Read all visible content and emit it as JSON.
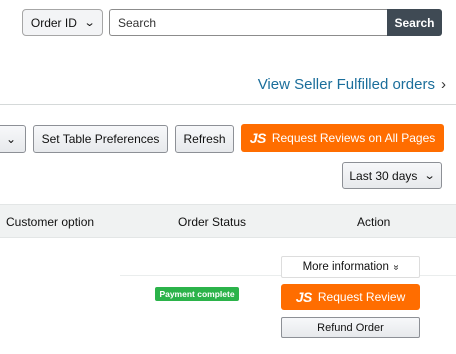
{
  "search": {
    "filter_label": "Order ID",
    "placeholder": "Search",
    "button_label": "Search"
  },
  "links": {
    "seller_fulfilled": "View Seller Fulfilled orders",
    "seller_fulfilled_chevron": "›"
  },
  "toolbar": {
    "small_dropdown_chevron": "⌄",
    "table_prefs_label": "Set Table Preferences",
    "refresh_label": "Refresh",
    "js_logo": "JS",
    "review_all_label": "Request Reviews on All Pages",
    "date_range_label": "Last 30 days",
    "date_range_chevron": "⌄"
  },
  "table": {
    "headers": [
      "Customer option",
      "Order Status",
      "Action"
    ],
    "row": {
      "more_info_label": "More information",
      "more_info_chevron": "»",
      "status_badge": "Payment complete",
      "js_logo": "JS",
      "request_review_label": "Request Review",
      "refund_label": "Refund Order"
    }
  },
  "colors": {
    "accent_orange": "#ff6d00",
    "link_blue": "#1b6e9b",
    "search_button": "#3f4a54",
    "status_green": "#2bb34a"
  }
}
